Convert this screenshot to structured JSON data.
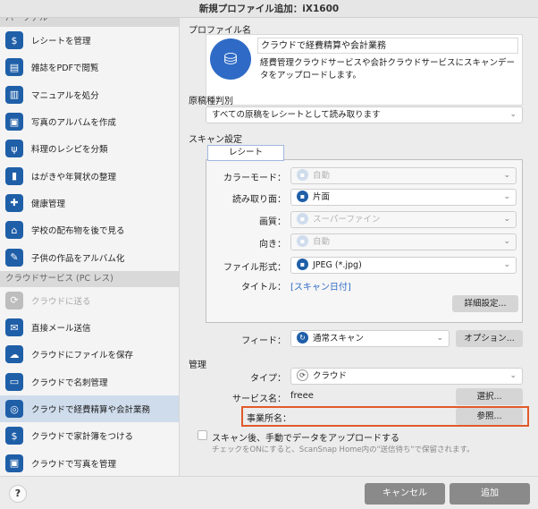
{
  "window": {
    "title": "新規プロファイル追加：iX1600"
  },
  "sidebar": {
    "sections": [
      {
        "header": "パーソナル",
        "items": [
          {
            "label": "レシートを管理",
            "icon": "receipt-icon",
            "glyph": "$"
          },
          {
            "label": "雑誌をPDFで閲覧",
            "icon": "magazine-icon",
            "glyph": "▤"
          },
          {
            "label": "マニュアルを処分",
            "icon": "manual-icon",
            "glyph": "▥"
          },
          {
            "label": "写真のアルバムを作成",
            "icon": "photo-album-icon",
            "glyph": "▣"
          },
          {
            "label": "料理のレシピを分類",
            "icon": "recipe-icon",
            "glyph": "ψ"
          },
          {
            "label": "はがきや年賀状の整理",
            "icon": "postcard-icon",
            "glyph": "▮"
          },
          {
            "label": "健康管理",
            "icon": "health-icon",
            "glyph": "✚"
          },
          {
            "label": "学校の配布物を後で見る",
            "icon": "school-icon",
            "glyph": "⌂"
          },
          {
            "label": "子供の作品をアルバム化",
            "icon": "kids-art-icon",
            "glyph": "✎"
          }
        ]
      },
      {
        "header": "クラウドサービス (PC レス)",
        "items": [
          {
            "label": "クラウドに送る",
            "icon": "cloud-send-icon",
            "glyph": "⟳",
            "disabled": true
          },
          {
            "label": "直接メール送信",
            "icon": "mail-icon",
            "glyph": "✉"
          },
          {
            "label": "クラウドにファイルを保存",
            "icon": "cloud-save-icon",
            "glyph": "☁"
          },
          {
            "label": "クラウドで名刺管理",
            "icon": "business-card-icon",
            "glyph": "▭"
          },
          {
            "label": "クラウドで経費精算や会計業務",
            "icon": "expense-icon",
            "glyph": "◎",
            "selected": true
          },
          {
            "label": "クラウドで家計簿をつける",
            "icon": "household-budget-icon",
            "glyph": "$"
          },
          {
            "label": "クラウドで写真を管理",
            "icon": "cloud-photo-icon",
            "glyph": "▣"
          }
        ]
      }
    ]
  },
  "profile": {
    "label": "プロファイル名",
    "name": "クラウドで経費精算や会計業務",
    "description": "経費管理クラウドサービスや会計クラウドサービスにスキャンデータをアップロードします。",
    "icon": "coin-stack-icon"
  },
  "doc_type": {
    "label": "原稿種判別",
    "value": "すべての原稿をレシートとして読み取ります"
  },
  "scan_settings": {
    "label": "スキャン設定",
    "tab": "レシート",
    "rows": [
      {
        "key": "color_mode",
        "label": "カラーモード：",
        "value": "自動",
        "icon": "color-mode-icon",
        "disabled": true
      },
      {
        "key": "side",
        "label": "読み取り面：",
        "value": "片面",
        "icon": "single-side-icon",
        "disabled": false
      },
      {
        "key": "quality",
        "label": "画質：",
        "value": "スーパーファイン",
        "icon": "quality-icon",
        "disabled": true
      },
      {
        "key": "orientation",
        "label": "向き：",
        "value": "自動",
        "icon": "orientation-icon",
        "disabled": true
      },
      {
        "key": "file_format",
        "label": "ファイル形式：",
        "value": "JPEG (*.jpg)",
        "icon": "jpeg-icon",
        "disabled": false
      }
    ],
    "title_label": "タイトル：",
    "title_value": "[スキャン日付]",
    "detail_button": "詳細設定..."
  },
  "feed": {
    "label": "フィード：",
    "value": "通常スキャン",
    "options_button": "オプション..."
  },
  "management": {
    "label": "管理",
    "type_label": "タイプ：",
    "type_value": "クラウド",
    "service_label": "サービス名：",
    "service_value": "freee",
    "select_button": "選択...",
    "office_label": "事業所名：",
    "browse_button": "参照..."
  },
  "upload_option": {
    "label": "スキャン後、手動でデータをアップロードする",
    "hint": "チェックをONにすると、ScanSnap Home内の\"送信待ち\"で保留されます。",
    "checked": false
  },
  "footer": {
    "help": "?",
    "cancel": "キャンセル",
    "add": "追加"
  }
}
